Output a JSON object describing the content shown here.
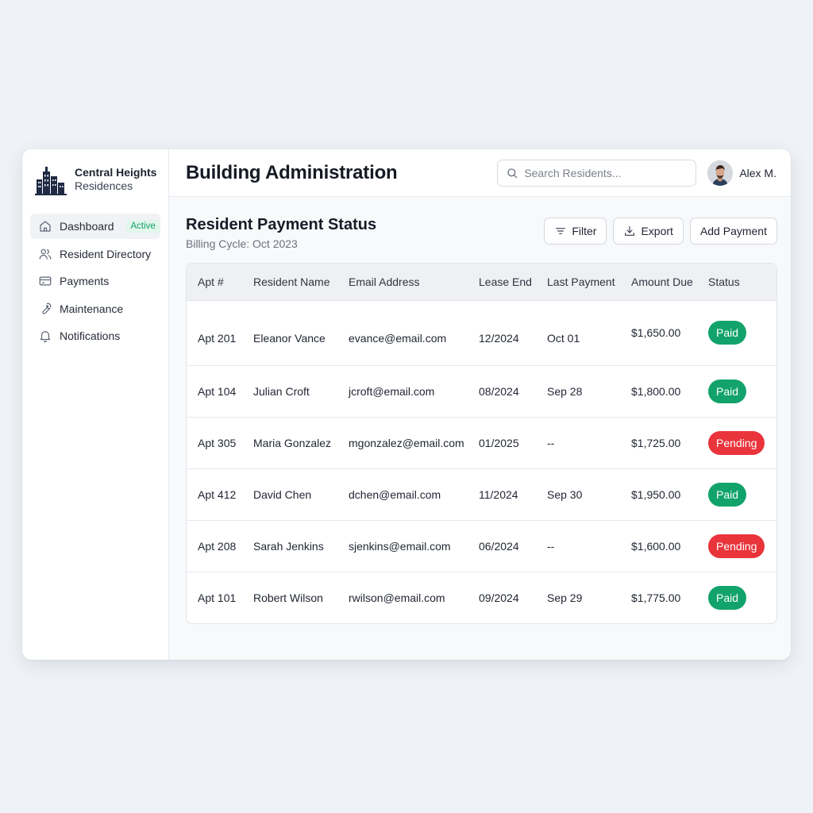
{
  "brand": {
    "name": "Central Heights",
    "sub": "Residences"
  },
  "sidebar": {
    "items": [
      {
        "label": "Dashboard",
        "icon": "home-icon",
        "badge": "Active"
      },
      {
        "label": "Resident Directory",
        "icon": "users-icon"
      },
      {
        "label": "Payments",
        "icon": "credit-card-icon"
      },
      {
        "label": "Maintenance",
        "icon": "wrench-icon"
      },
      {
        "label": "Notifications",
        "icon": "bell-icon"
      }
    ]
  },
  "header": {
    "title": "Building Administration",
    "search_placeholder": "Search Residents...",
    "user_name": "Alex M."
  },
  "section": {
    "title": "Resident Payment Status",
    "subtitle": "Billing Cycle: Oct 2023",
    "filter_label": "Filter",
    "export_label": "Export",
    "add_label": "Add Payment"
  },
  "table": {
    "columns": [
      "Apt #",
      "Resident Name",
      "Email Address",
      "Lease End",
      "Last Payment",
      "Amount Due",
      "Status"
    ],
    "rows": [
      {
        "apt": "Apt 201",
        "name": "Eleanor Vance",
        "email": "evance@email.com",
        "lease": "12/2024",
        "last": "Oct 01",
        "amount": "$1,650.00",
        "status": "Paid"
      },
      {
        "apt": "Apt 104",
        "name": "Julian Croft",
        "email": "jcroft@email.com",
        "lease": "08/2024",
        "last": "Sep 28",
        "amount": "$1,800.00",
        "status": "Paid"
      },
      {
        "apt": "Apt 305",
        "name": "Maria Gonzalez",
        "email": "mgonzalez@email.com",
        "lease": "01/2025",
        "last": "--",
        "amount": "$1,725.00",
        "status": "Pending"
      },
      {
        "apt": "Apt 412",
        "name": "David Chen",
        "email": "dchen@email.com",
        "lease": "11/2024",
        "last": "Sep 30",
        "amount": "$1,950.00",
        "status": "Paid"
      },
      {
        "apt": "Apt 208",
        "name": "Sarah Jenkins",
        "email": "sjenkins@email.com",
        "lease": "06/2024",
        "last": "--",
        "amount": "$1,600.00",
        "status": "Pending"
      },
      {
        "apt": "Apt 101",
        "name": "Robert Wilson",
        "email": "rwilson@email.com",
        "lease": "09/2024",
        "last": "Sep 29",
        "amount": "$1,775.00",
        "status": "Paid"
      }
    ]
  },
  "colors": {
    "paid": "#12a36b",
    "pending": "#e9343b",
    "active_badge": "#16a067"
  }
}
